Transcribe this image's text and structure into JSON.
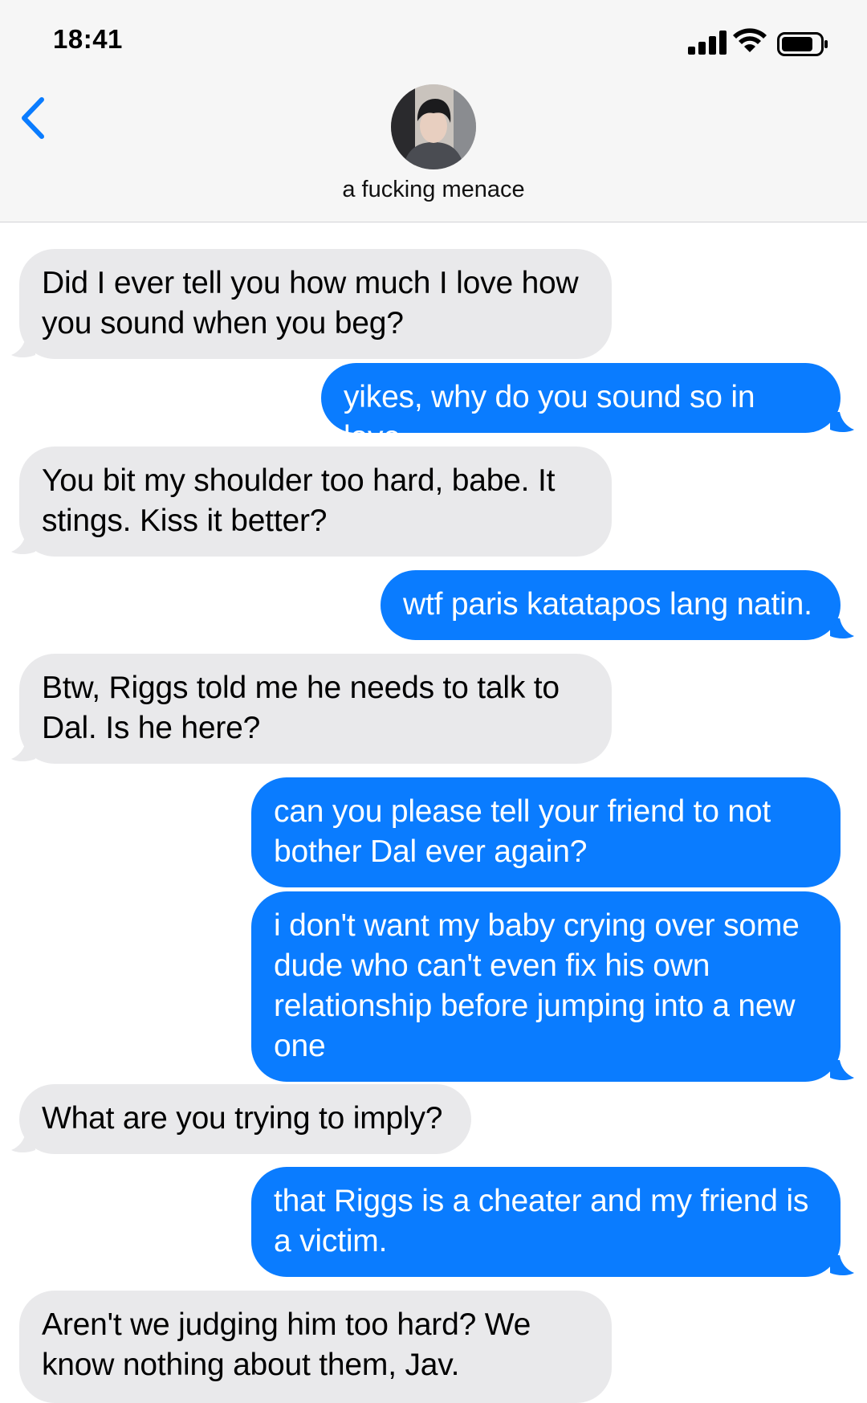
{
  "status_bar": {
    "time": "18:41",
    "signal_icon": "cellular-signal-icon",
    "wifi_icon": "wifi-icon",
    "battery_icon": "battery-icon"
  },
  "header": {
    "back_icon": "chevron-left-icon",
    "contact_name": "a fucking menace"
  },
  "colors": {
    "incoming_bubble": "#e9e9eb",
    "outgoing_bubble": "#0a7cff",
    "accent": "#0a7cff",
    "header_bg": "#f6f6f6"
  },
  "messages": [
    {
      "direction": "incoming",
      "text": "Did I ever tell you how much I love how you sound when you beg?"
    },
    {
      "direction": "outgoing",
      "text": "yikes, why do you sound so in love"
    },
    {
      "direction": "incoming",
      "text": "You bit my shoulder too hard, babe. It stings. Kiss it better?"
    },
    {
      "direction": "outgoing",
      "text": "wtf paris katatapos lang natin."
    },
    {
      "direction": "incoming",
      "text": "Btw, Riggs told me he needs to talk to Dal. Is he here?"
    },
    {
      "direction": "outgoing",
      "text": "can you please tell your friend to not bother Dal ever again?"
    },
    {
      "direction": "outgoing",
      "text": "i don't want my baby crying over some dude who can't even fix his own relationship before jumping into a new one"
    },
    {
      "direction": "incoming",
      "text": "What are you trying to imply?"
    },
    {
      "direction": "outgoing",
      "text": "that Riggs is a cheater and my friend is a victim."
    },
    {
      "direction": "incoming",
      "text": "Aren't we judging him too hard? We know nothing about them, Jav."
    }
  ]
}
